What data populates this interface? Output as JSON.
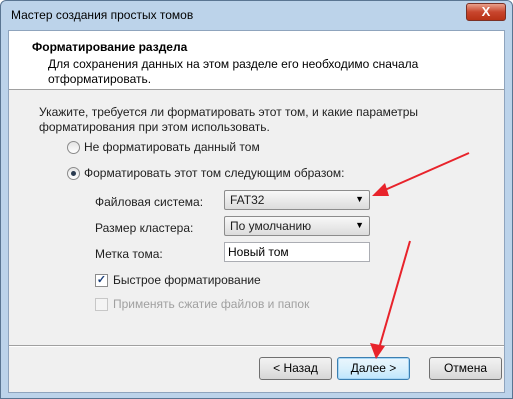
{
  "window": {
    "title": "Мастер создания простых томов",
    "close_label": "X"
  },
  "header": {
    "title": "Форматирование раздела",
    "description": "Для сохранения данных на этом разделе его необходимо сначала отформатировать."
  },
  "body": {
    "instruction": "Укажите, требуется ли форматировать этот том, и какие параметры форматирования при этом использовать.",
    "radio_no_format": "Не форматировать данный том",
    "radio_format": "Форматировать этот том следующим образом:",
    "filesystem_label": "Файловая система:",
    "filesystem_value": "FAT32",
    "cluster_label": "Размер кластера:",
    "cluster_value": "По умолчанию",
    "volume_label_label": "Метка тома:",
    "volume_label_value": "Новый том",
    "quick_format_label": "Быстрое форматирование",
    "compression_label": "Применять сжатие файлов и папок"
  },
  "buttons": {
    "back": "< Назад",
    "next": "Далее >",
    "cancel": "Отмена"
  },
  "colors": {
    "annotation_arrow": "#e8232b",
    "window_frame": "#bcd3ea"
  }
}
